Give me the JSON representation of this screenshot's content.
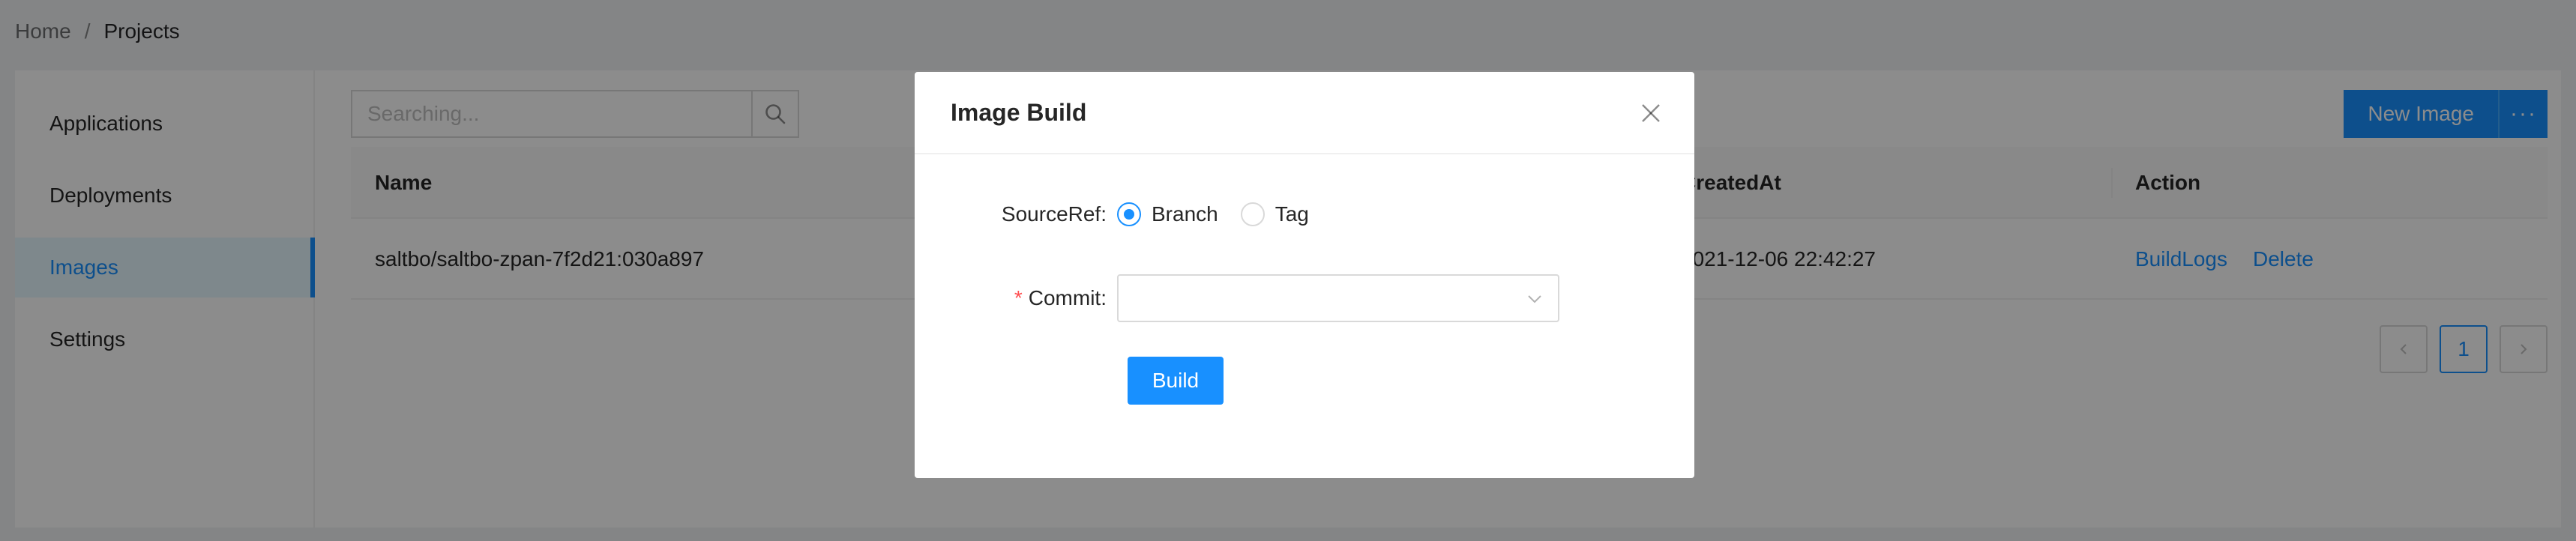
{
  "breadcrumb": {
    "home": "Home",
    "separator": "/",
    "current": "Projects"
  },
  "sidebar": {
    "items": [
      {
        "label": "Applications"
      },
      {
        "label": "Deployments"
      },
      {
        "label": "Images"
      },
      {
        "label": "Settings"
      }
    ]
  },
  "search": {
    "placeholder": "Searching..."
  },
  "toolbar": {
    "new_image": "New Image",
    "more": "···"
  },
  "table": {
    "headers": {
      "name": "Name",
      "created": "CreatedAt",
      "action": "Action"
    },
    "rows": [
      {
        "name": "saltbo/saltbo-zpan-7f2d21:030a897",
        "created": "2021-12-06 22:42:27",
        "build_logs": "BuildLogs",
        "delete": "Delete"
      }
    ]
  },
  "pagination": {
    "current_page": "1"
  },
  "modal": {
    "title": "Image Build",
    "source_ref_label": "SourceRef",
    "options": {
      "branch": "Branch",
      "tag": "Tag"
    },
    "selected_option": "Branch",
    "commit_required_mark": "*",
    "commit_label": "Commit",
    "commit_value": "",
    "build_label": "Build"
  },
  "colors": {
    "primary": "#1890ff",
    "required": "#ff4d4f",
    "mask": "rgba(0,0,0,0.45)"
  },
  "icons": [
    "search-icon",
    "close-icon",
    "chevron-down-icon",
    "chevron-left-icon",
    "chevron-right-icon"
  ]
}
